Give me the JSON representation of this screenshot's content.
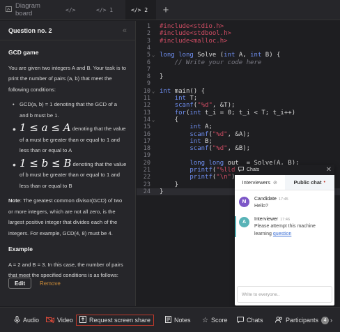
{
  "tabs": [
    {
      "label": "Diagram board",
      "icon": "diagram-icon"
    },
    {
      "label": "</>",
      "icon": "code-icon"
    },
    {
      "label": "</> 1",
      "icon": "code-icon"
    },
    {
      "label": "</> 2",
      "icon": "code-icon",
      "active": true
    }
  ],
  "question": {
    "title": "Question no. 2",
    "heading": "GCD game",
    "intro": "You are given two integers A and B. Your task is to print the number of pairs (a, b) that meet the following conditions:",
    "conditions": [
      {
        "text": "GCD(a, b) = 1 denoting that the GCD of a and b must be 1."
      },
      {
        "math": "1 ≤ a ≤ A",
        "text": "denoting that the value of a must be greater than or equal to 1 and less than or equal to A"
      },
      {
        "math": "1 ≤ b ≤ B",
        "text": "denoting that the value of b must be greater than or equal to 1 and less than or equal to B"
      }
    ],
    "note_label": "Note",
    "note": ": The greatest common divisor(GCD) of two or more integers, which are not all zero, is the largest positive integer that divides each of the integers. For example, GCD(4, 8) must be 4.",
    "example_heading": "Example",
    "example": "A = 2 and B = 3. In this case, the number of pairs that meet the specified conditions is as follows:",
    "edit_label": "Edit",
    "remove_label": "Remove"
  },
  "editor": {
    "lines": [
      {
        "n": "1",
        "text": "#include<stdio.h>"
      },
      {
        "n": "2",
        "text": "#include<stdbool.h>"
      },
      {
        "n": "3",
        "text": "#include<malloc.h>"
      },
      {
        "n": "4",
        "text": ""
      },
      {
        "n": "5",
        "text": "long long Solve (int A, int B) {"
      },
      {
        "n": "6",
        "text": "    // Write your code here"
      },
      {
        "n": "7",
        "text": ""
      },
      {
        "n": "8",
        "text": "}"
      },
      {
        "n": "9",
        "text": ""
      },
      {
        "n": "10",
        "text": "int main() {"
      },
      {
        "n": "11",
        "text": "    int T;"
      },
      {
        "n": "12",
        "text": "    scanf(\"%d\", &T);"
      },
      {
        "n": "13",
        "text": "    for(int t_i = 0; t_i < T; t_i++)"
      },
      {
        "n": "14",
        "text": "    {"
      },
      {
        "n": "15",
        "text": "        int A;"
      },
      {
        "n": "16",
        "text": "        scanf(\"%d\", &A);"
      },
      {
        "n": "17",
        "text": "        int B;"
      },
      {
        "n": "18",
        "text": "        scanf(\"%d\", &B);"
      },
      {
        "n": "19",
        "text": ""
      },
      {
        "n": "20",
        "text": "        long long out_ = Solve(A, B);"
      },
      {
        "n": "21",
        "text": "        printf(\"%lld"
      },
      {
        "n": "22",
        "text": "        printf(\"\\n\")"
      },
      {
        "n": "23",
        "text": "    }"
      },
      {
        "n": "24",
        "text": "}"
      }
    ]
  },
  "chat": {
    "title": "Chats",
    "tab_interviewers": "Interviewers",
    "tab_public": "Public chat",
    "messages": [
      {
        "initial": "M",
        "author": "Candidate",
        "time": "17:45",
        "text": "Hello?"
      },
      {
        "initial": "A",
        "author": "Interviewer",
        "time": "17:46",
        "text": "Please attempt this machine learning",
        "link": "question"
      }
    ],
    "input_placeholder": "Write to everyone.."
  },
  "bottom": {
    "audio": "Audio",
    "video": "Video",
    "share": "Request screen share",
    "notes": "Notes",
    "score": "Score",
    "chats": "Chats",
    "participants": "Participants",
    "participants_count": "4"
  }
}
